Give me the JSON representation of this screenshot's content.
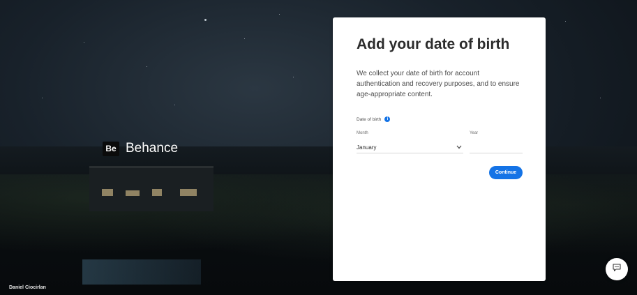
{
  "brand": {
    "logo_text": "Be",
    "name": "Behance"
  },
  "photo_credit": "Daniel Ciocirlan",
  "form": {
    "title": "Add your date of birth",
    "description": "We collect your date of birth for account authentication and recovery purposes, and to ensure age-appropriate content.",
    "dob_label": "Date of birth",
    "info_icon_glyph": "i",
    "month_label": "Month",
    "month_value": "January",
    "year_label": "Year",
    "year_value": "",
    "continue_label": "Continue"
  },
  "icons": {
    "info": "info-icon",
    "chevron": "chevron-down-icon",
    "feedback": "chat-feedback-icon"
  },
  "colors": {
    "accent": "#1473e6",
    "card_bg": "#ffffff",
    "title_text": "#2c2c2c"
  }
}
